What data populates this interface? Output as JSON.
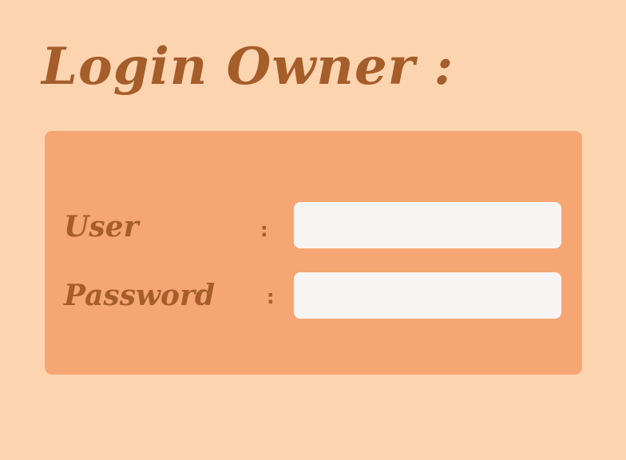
{
  "page": {
    "title": "Login Owner :"
  },
  "form": {
    "user": {
      "label": "User",
      "separator": ":",
      "value": "",
      "placeholder": ""
    },
    "password": {
      "label": "Password",
      "separator": ":",
      "value": "",
      "placeholder": ""
    }
  },
  "colors": {
    "background": "#fdd4b0",
    "panel": "#f6a672",
    "text": "#a55d2a",
    "input_background": "#f7f5f3"
  }
}
